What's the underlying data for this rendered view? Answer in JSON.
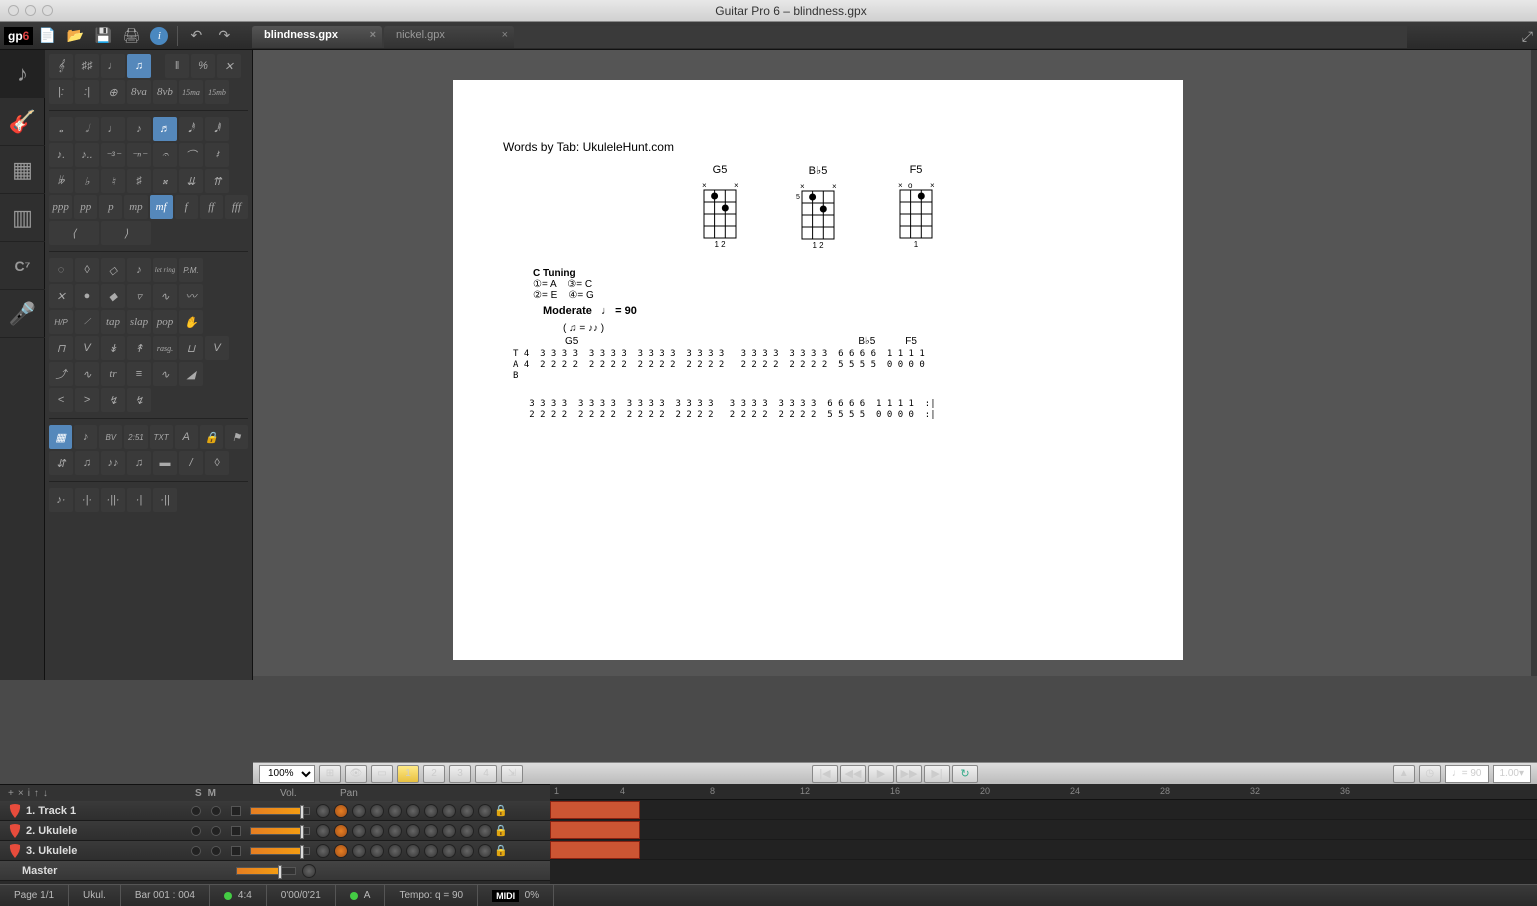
{
  "app": {
    "title": "Guitar Pro 6 – blindness.gpx",
    "logo": "gp",
    "logoVersion": "6"
  },
  "tabs": [
    {
      "label": "blindness.gpx",
      "active": true
    },
    {
      "label": "nickel.gpx",
      "active": false
    }
  ],
  "doc": {
    "words_by": "Words by Tab: UkuleleHunt.com",
    "chords": [
      {
        "name": "G5",
        "fingers": "1  2"
      },
      {
        "name": "B♭5",
        "fingers": "1  2"
      },
      {
        "name": "F5",
        "fingers": "1"
      }
    ],
    "tuning_label": "C Tuning",
    "tuning": [
      {
        "n": "①",
        "note": "A"
      },
      {
        "n": "③",
        "note": "C"
      },
      {
        "n": "②",
        "note": "E"
      },
      {
        "n": "④",
        "note": "G"
      }
    ],
    "tempo_label": "Moderate",
    "tempo_value": "= 90",
    "swing": "( ♫ = ♪♪ )",
    "bar_labels": {
      "m1_chord": "G5",
      "m2_chord1": "B♭5",
      "m2_chord2": "F5"
    },
    "tab_line1": "T 4  3 3 3 3  3 3 3 3  3 3 3 3  3 3 3 3   3 3 3 3  3 3 3 3  6 6 6 6  1 1 1 1\nA 4  2 2 2 2  2 2 2 2  2 2 2 2  2 2 2 2   2 2 2 2  2 2 2 2  5 5 5 5  0 0 0 0\nB",
    "tab_line2": "   3 3 3 3  3 3 3 3  3 3 3 3  3 3 3 3   3 3 3 3  3 3 3 3  6 6 6 6  1 1 1 1  :|\n   2 2 2 2  2 2 2 2  2 2 2 2  2 2 2 2   2 2 2 2  2 2 2 2  5 5 5 5  0 0 0 0  :|"
  },
  "zoom": {
    "value": "100%",
    "pages": [
      "1",
      "2",
      "3",
      "4"
    ],
    "active_page": "1"
  },
  "tempo_control": {
    "bpm": "= 90",
    "speed": "1.00"
  },
  "track_header": {
    "vol": "Vol.",
    "pan": "Pan",
    "s": "S",
    "m": "M"
  },
  "tracks": [
    {
      "name": "1. Track 1",
      "vol": 85,
      "color": "pick"
    },
    {
      "name": "2. Ukulele",
      "vol": 85,
      "color": "pick"
    },
    {
      "name": "3. Ukulele",
      "vol": 85,
      "color": "pick"
    }
  ],
  "master": {
    "name": "Master",
    "vol": 70
  },
  "ruler": {
    "marks": [
      1,
      4,
      8,
      12,
      16,
      20,
      24,
      28,
      32,
      36
    ]
  },
  "status": {
    "page": "Page 1/1",
    "instrument": "Ukul.",
    "bar": "Bar 001 : 004",
    "time_sig": "4:4",
    "duration": "0'00/0'21",
    "key": "A",
    "tempo": "Tempo: q = 90",
    "midi": "MIDI",
    "buffer": "0%"
  },
  "dynamics": [
    "ppp",
    "pp",
    "p",
    "mp",
    "mf",
    "f",
    "ff",
    "fff"
  ],
  "techniques": [
    "tap",
    "slap",
    "pop"
  ],
  "octaves": [
    "8va",
    "8vb",
    "15ma",
    "15mb"
  ],
  "automation": [
    "BV",
    "2:51",
    "TXT"
  ],
  "palette": {
    "rasg": "rasg.",
    "pm": "P.M.",
    "tr": "tr",
    "let_ring": "let ring"
  }
}
